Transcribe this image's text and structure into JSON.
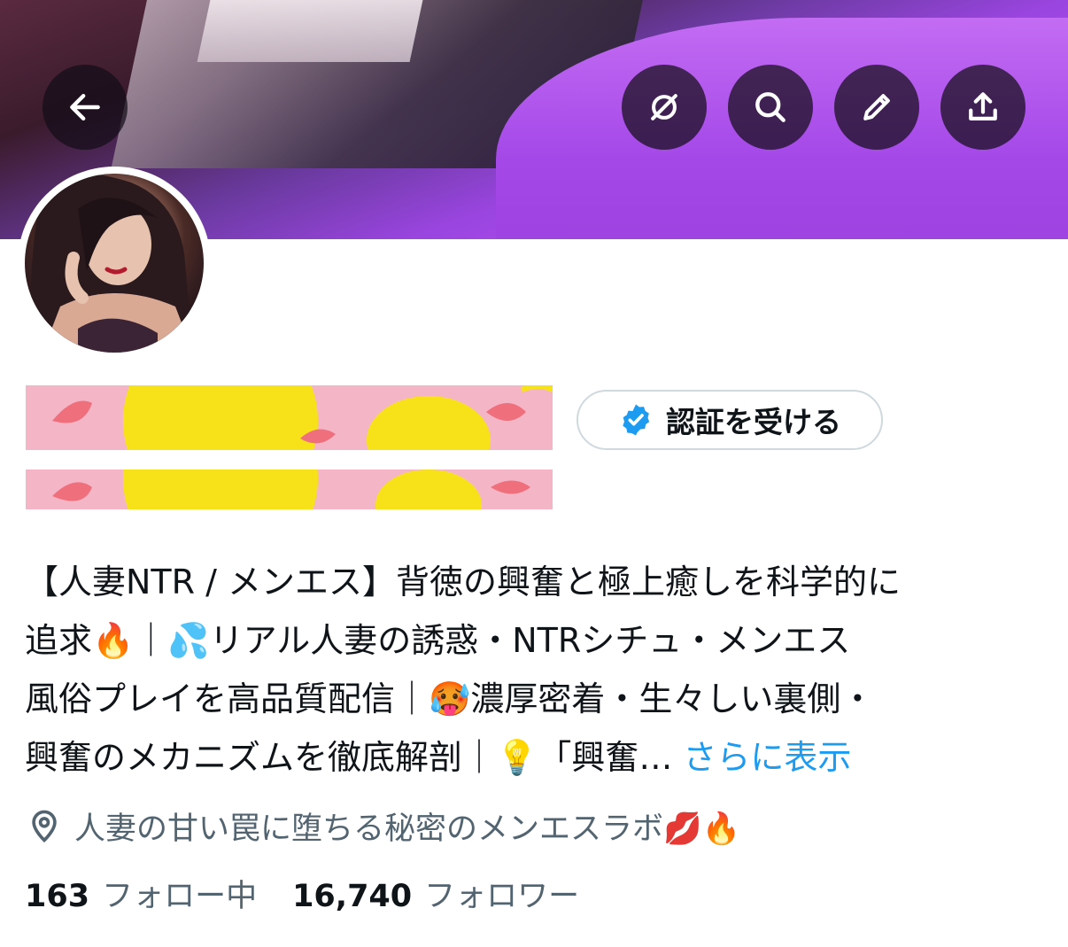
{
  "header": {
    "back_icon": "arrow-left-icon",
    "actions": [
      "hide-crossed-circle-icon",
      "search-icon",
      "edit-pencil-icon",
      "share-upload-icon"
    ]
  },
  "profile": {
    "verify_button_label": "認証を受ける",
    "bio_lines": [
      "【人妻NTR / メンエス】背徳の興奮と極上癒しを科学的に",
      "追求🔥｜💦リアル人妻の誘惑・NTRシチュ・メンエス",
      "風俗プレイを高品質配信｜🥵濃厚密着・生々しい裏側・",
      "興奮のメカニズムを徹底解剖｜💡「興奮…"
    ],
    "show_more": "さらに表示",
    "location": "人妻の甘い罠に堕ちる秘密のメンエスラボ💋🔥",
    "following_count": "163",
    "following_label": "フォロー中",
    "followers_count": "16,740",
    "followers_label": "フォロワー"
  },
  "colors": {
    "link": "#1d9bf0",
    "secondary_text": "#536471",
    "verified_badge": "#1d9bf0"
  }
}
